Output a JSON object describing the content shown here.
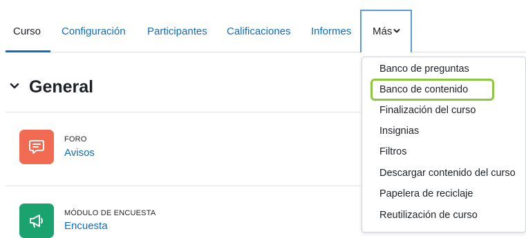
{
  "tabs": {
    "items": [
      {
        "label": "Curso"
      },
      {
        "label": "Configuración"
      },
      {
        "label": "Participantes"
      },
      {
        "label": "Calificaciones"
      },
      {
        "label": "Informes"
      }
    ],
    "more": {
      "label": "Más",
      "icon": "chevron-down-icon"
    }
  },
  "section": {
    "title": "General",
    "icon": "chevron-down-icon"
  },
  "activities": [
    {
      "type": "FORO",
      "name": "Avisos",
      "icon": "forum-icon",
      "color": "#f16a52"
    },
    {
      "type": "MÓDULO DE ENCUESTA",
      "name": "Encuesta",
      "icon": "megaphone-icon",
      "color": "#1aa36f"
    }
  ],
  "dropdown": {
    "items": [
      {
        "label": "Banco de preguntas"
      },
      {
        "label": "Banco de contenido"
      },
      {
        "label": "Finalización del curso"
      },
      {
        "label": "Insignias"
      },
      {
        "label": "Filtros"
      },
      {
        "label": "Descargar contenido del curso"
      },
      {
        "label": "Papelera de reciclaje"
      },
      {
        "label": "Reutilización de curso"
      }
    ],
    "highlighted": "Banco de contenido",
    "highlight_color": "#8dc63f"
  },
  "colors": {
    "link": "#0f6cbf",
    "text": "#1d2125",
    "active_border": "#5b9bd5"
  }
}
